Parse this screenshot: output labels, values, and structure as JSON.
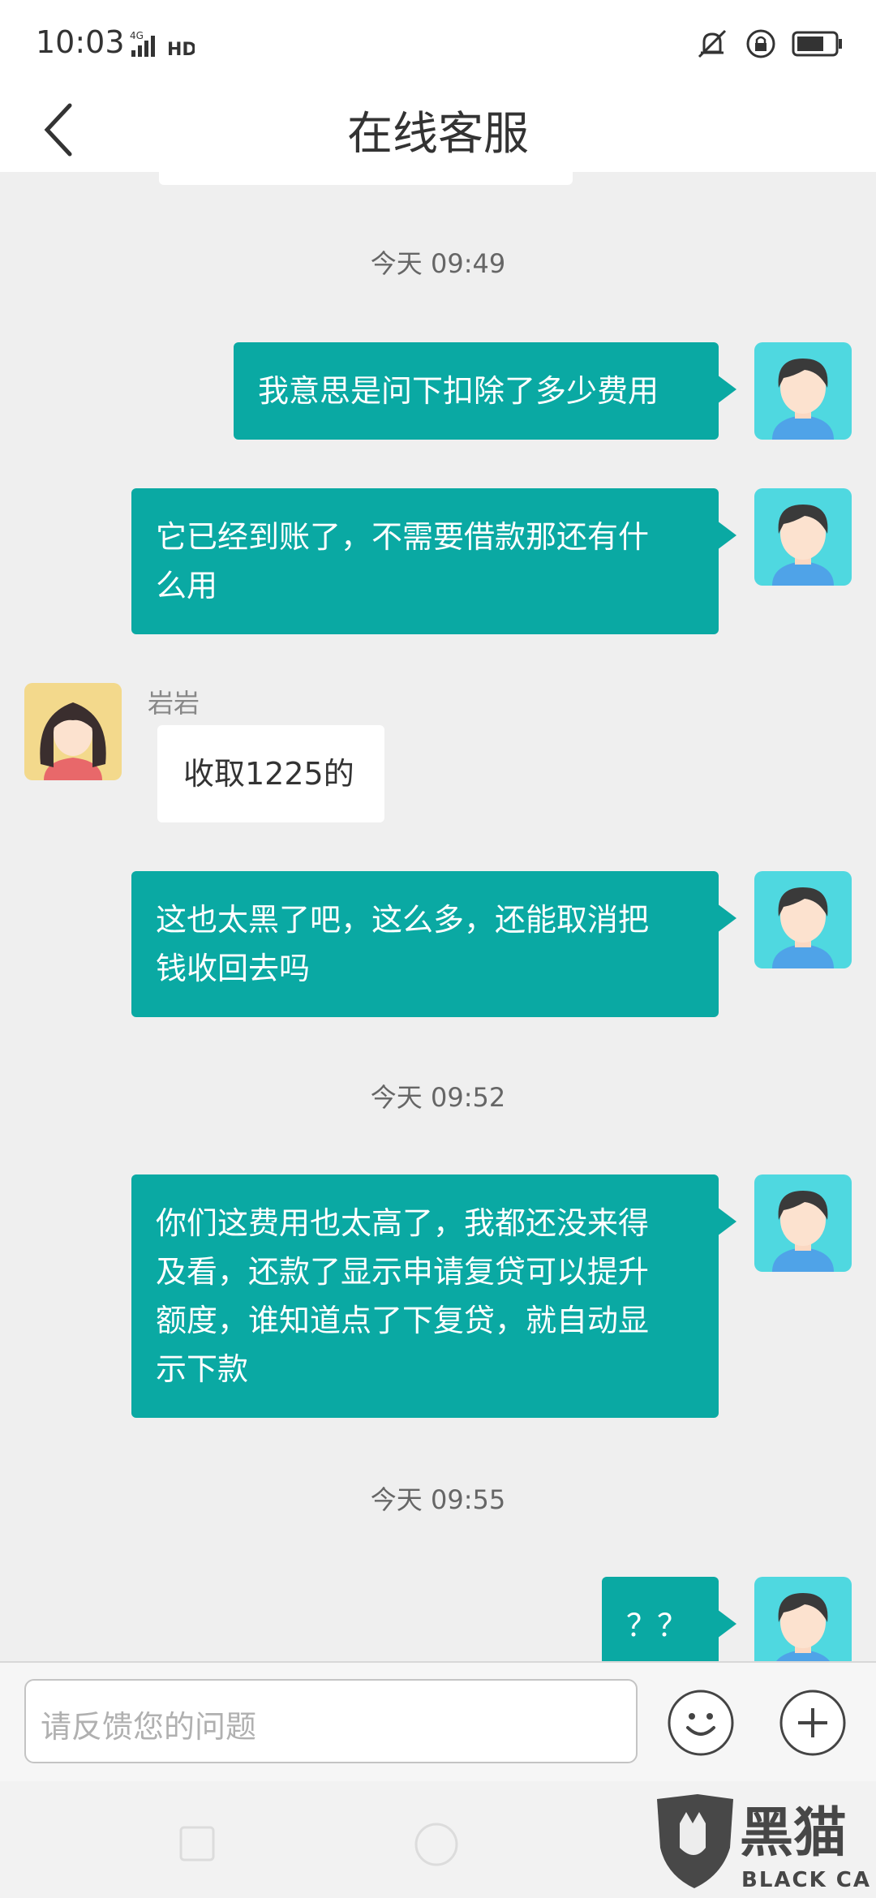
{
  "status": {
    "time": "10:03",
    "network": "4G",
    "hd": "HD"
  },
  "header": {
    "title": "在线客服"
  },
  "messages": {
    "ts1": "今天 09:49",
    "m1": "我意思是问下扣除了多少费用",
    "m2": [
      "它已经到账了，不需要借款那还有什",
      "么用"
    ],
    "agent_name": "岩岩",
    "m3": "收取1225的",
    "m4": [
      "这也太黑了吧，这么多，还能取消把",
      "钱收回去吗"
    ],
    "ts2": "今天 09:52",
    "m5": [
      "你们这费用也太高了，我都还没来得",
      "及看，还款了显示申请复贷可以提升",
      "额度，谁知道点了下复贷，就自动显",
      "示下款"
    ],
    "ts3": "今天 09:55",
    "m6": "？？"
  },
  "input": {
    "placeholder": "请反馈您的问题"
  },
  "watermark": {
    "text_cn": "黑猫",
    "text_en": "BLACK CAT"
  },
  "colors": {
    "accent": "#0aa9a3",
    "background": "#efefef"
  },
  "icons": [
    "back-arrow-icon",
    "emoji-icon",
    "plus-icon",
    "signal-icon",
    "mute-icon",
    "lock-icon",
    "battery-icon"
  ]
}
